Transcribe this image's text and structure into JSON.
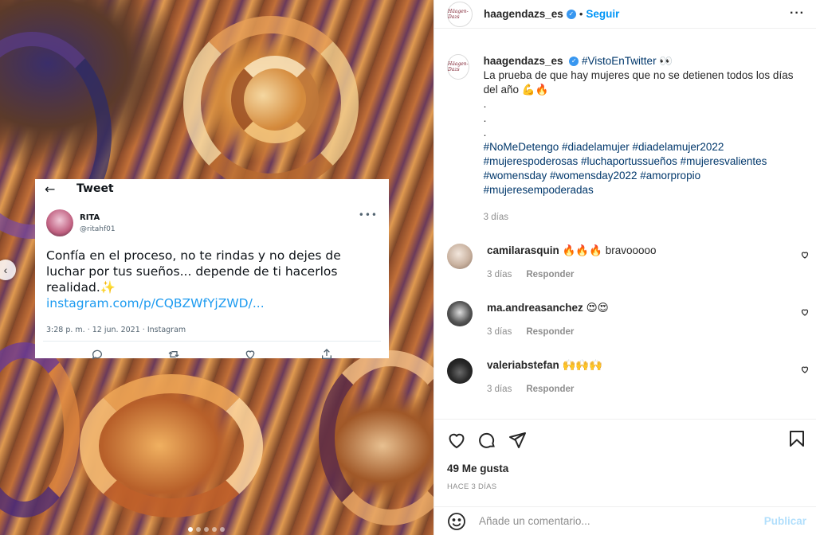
{
  "media": {
    "tweet": {
      "header_title": "Tweet",
      "back_icon": "arrow-left-icon",
      "author_name": "RITA",
      "author_handle": "@ritahf01",
      "more_label": "•••",
      "text": "Confía en el proceso, no te rindas y no dejes de luchar por tus sueños... depende de ti hacerlos realidad.✨",
      "link": "instagram.com/p/CQBZWfYjZWD/...",
      "meta": "3:28 p. m. · 12 jun. 2021 · Instagram"
    }
  },
  "post_header": {
    "username": "haagendazs_es",
    "brand_text": "Häagen-Dazs",
    "dot": "•",
    "follow_label": "Seguir",
    "more_label": "···"
  },
  "caption": {
    "username": "haagendazs_es",
    "tag": "#VistoEnTwitter 👀",
    "line1": "La prueba de que hay mujeres que no se detienen todos los días del año 💪🔥",
    "dot1": ".",
    "dot2": ".",
    "dot3": ".",
    "hashtags": "#NoMeDetengo #diadelamujer #diadelamujer2022 #mujerespoderosas #luchaportussueños #mujeresvalientes #womensday #womensday2022 #amorpropio #mujeresempoderadas",
    "time": "3 días"
  },
  "comments": [
    {
      "username": "camilarasquin",
      "text": "🔥🔥🔥 bravooooo",
      "time": "3 días",
      "reply": "Responder"
    },
    {
      "username": "ma.andreasanchez",
      "text": "😍😍",
      "time": "3 días",
      "reply": "Responder"
    },
    {
      "username": "valeriabstefan",
      "text": "🙌🙌🙌",
      "time": "3 días",
      "reply": "Responder"
    }
  ],
  "actions": {
    "likes": "49 Me gusta",
    "time_ago": "HACE 3 DÍAS"
  },
  "add_comment": {
    "placeholder": "Añade un comentario...",
    "publish_label": "Publicar"
  },
  "colors": {
    "accent": "#0095f6",
    "hashtag": "#00376b",
    "muted": "#8e8e8e",
    "twitter_blue": "#1d9bf0"
  }
}
